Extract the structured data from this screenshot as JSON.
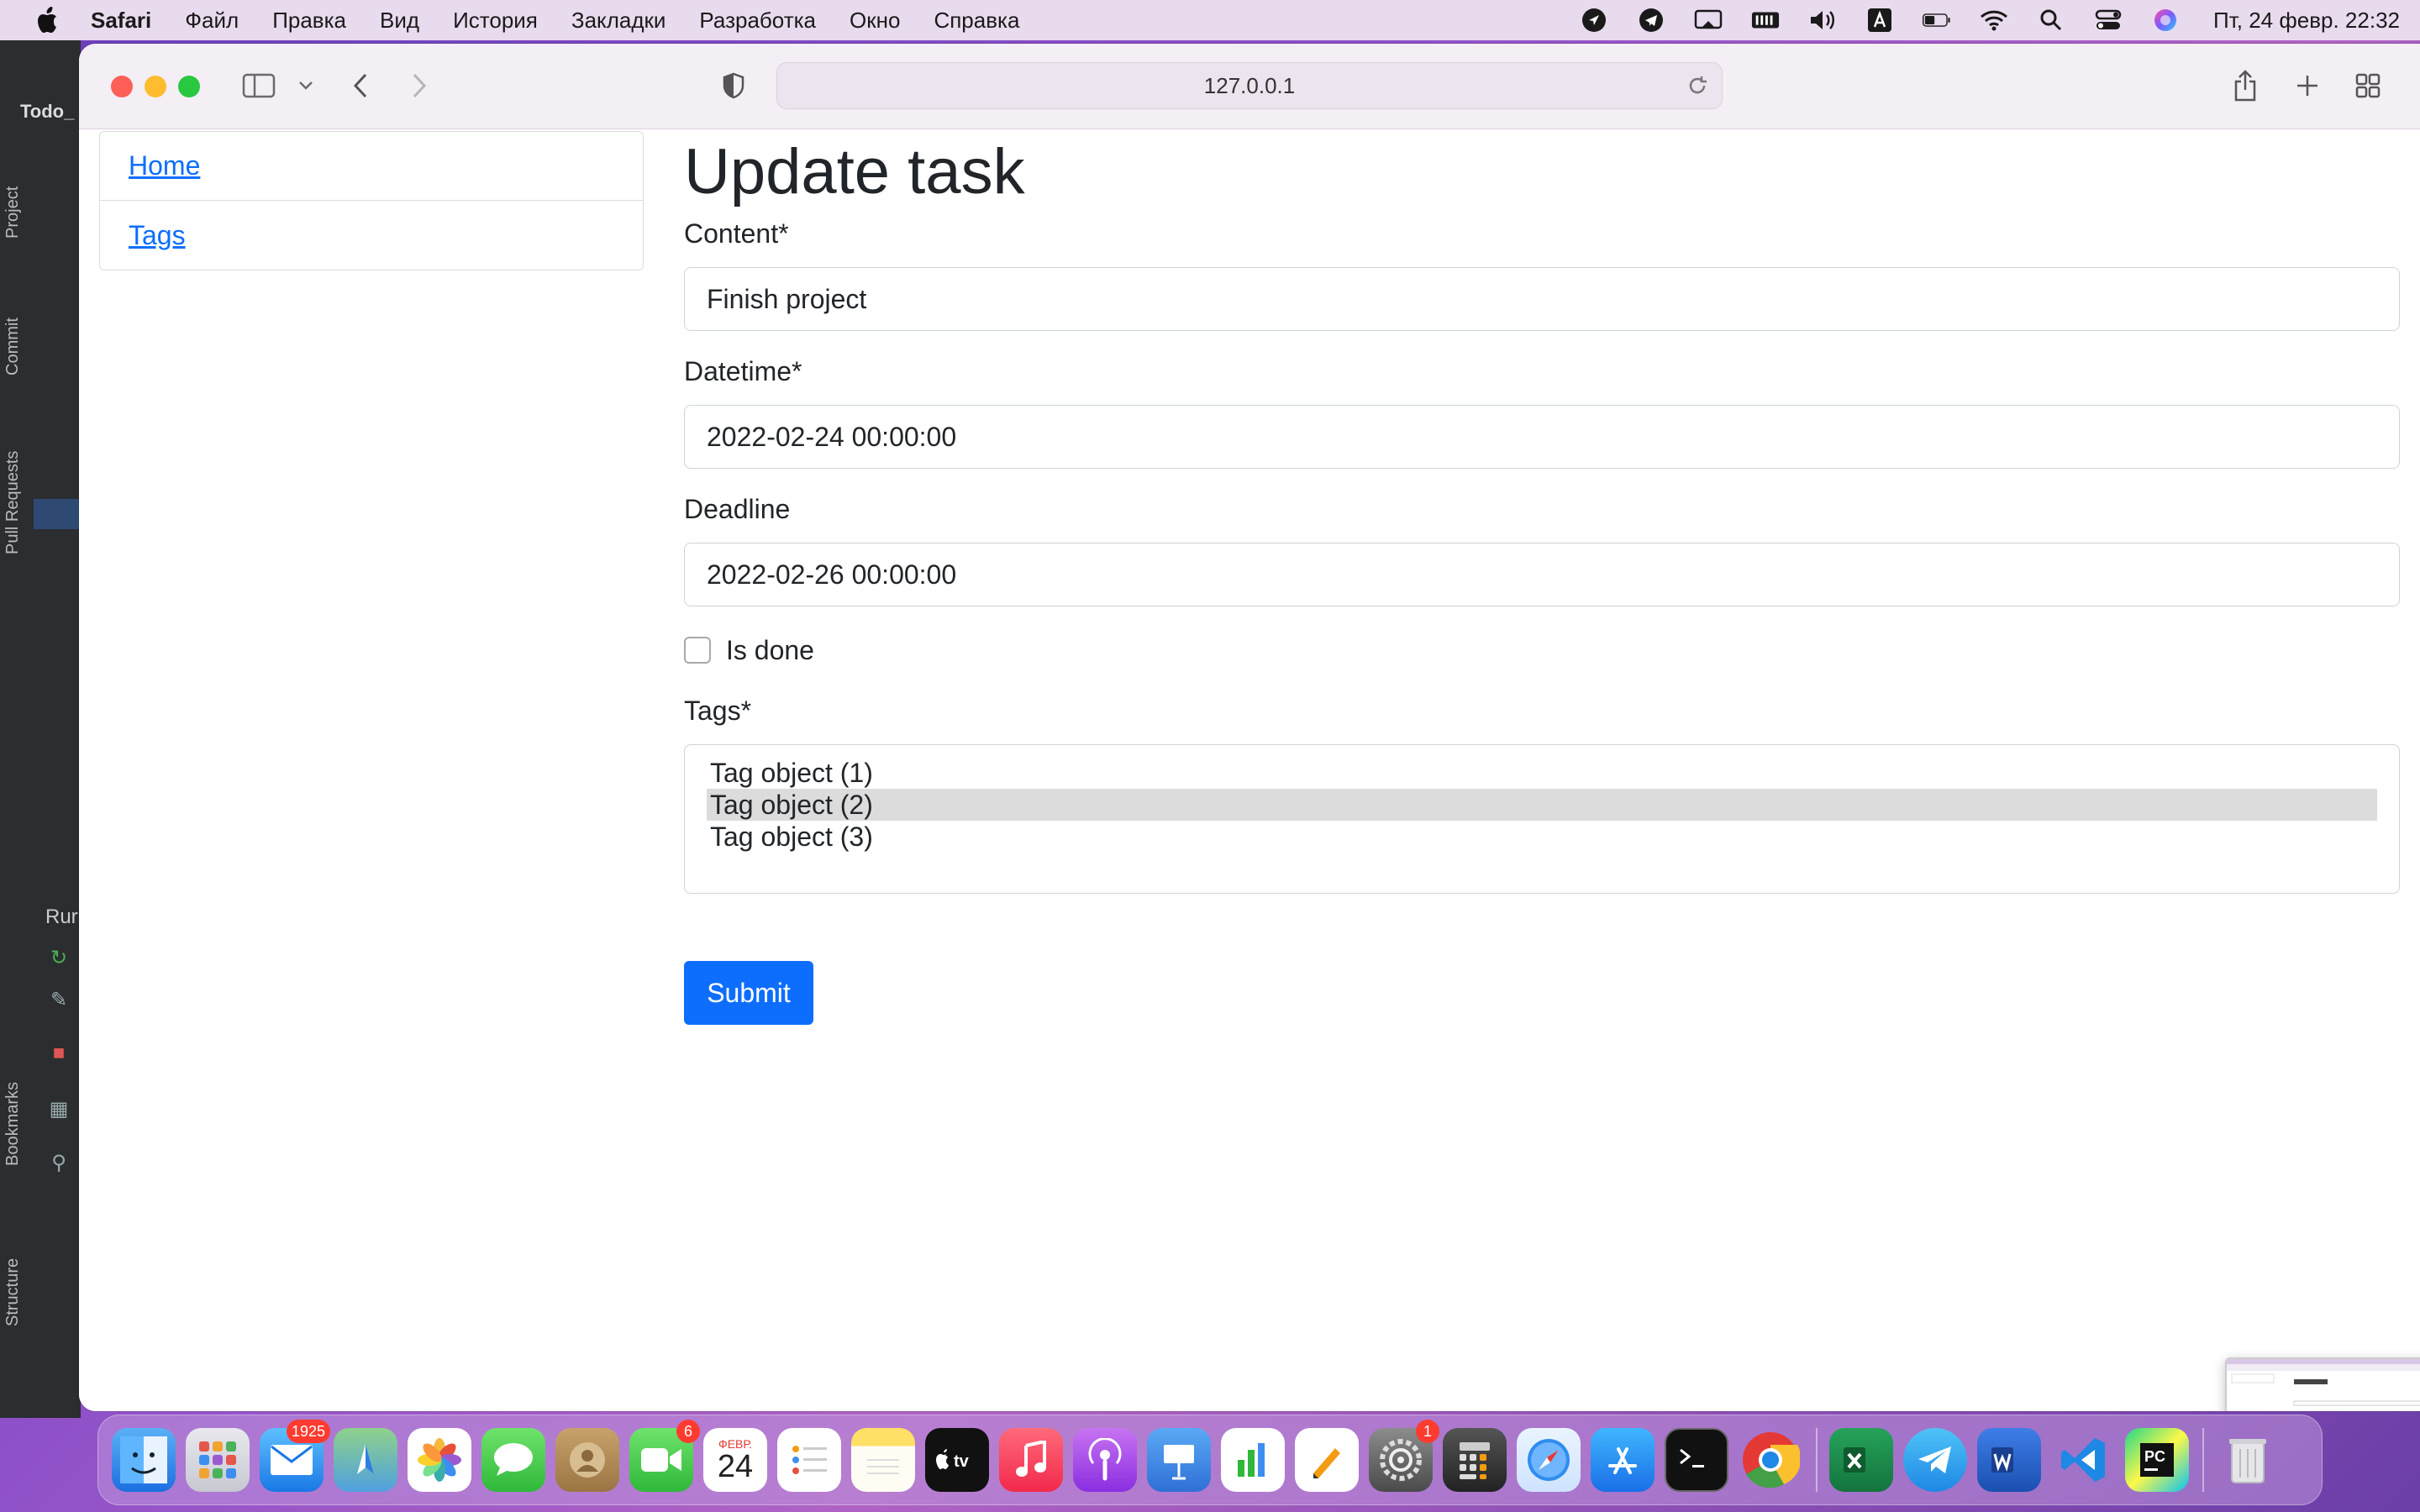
{
  "menubar": {
    "app": "Safari",
    "items": [
      "Файл",
      "Правка",
      "Вид",
      "История",
      "Закладки",
      "Разработка",
      "Окно",
      "Справка"
    ],
    "clock": "Пт, 24 февр.  22:32"
  },
  "ide": {
    "title": "Todo_",
    "tabs": [
      "Project",
      "Commit",
      "Pull Requests",
      "Bookmarks",
      "Structure"
    ],
    "run_label": "Rur"
  },
  "browser": {
    "url": "127.0.0.1"
  },
  "sidebar": {
    "items": [
      {
        "label": "Home"
      },
      {
        "label": "Tags"
      }
    ]
  },
  "form": {
    "title": "Update task",
    "content_label": "Content*",
    "content_value": "Finish project",
    "datetime_label": "Datetime*",
    "datetime_value": "2022-02-24 00:00:00",
    "deadline_label": "Deadline",
    "deadline_value": "2022-02-26 00:00:00",
    "is_done_label": "Is done",
    "is_done_checked": false,
    "tags_label": "Tags*",
    "tags_options": [
      "Tag object (1)",
      "Tag object (2)",
      "Tag object (3)"
    ],
    "tags_selected": "Tag object (2)",
    "submit_label": "Submit"
  },
  "dock": {
    "mail_badge": "1925",
    "facetime_badge": "6",
    "calendar_month": "ФЕВР.",
    "calendar_day": "24",
    "settings_badge": "1",
    "accent_color": "#0d6efd"
  }
}
